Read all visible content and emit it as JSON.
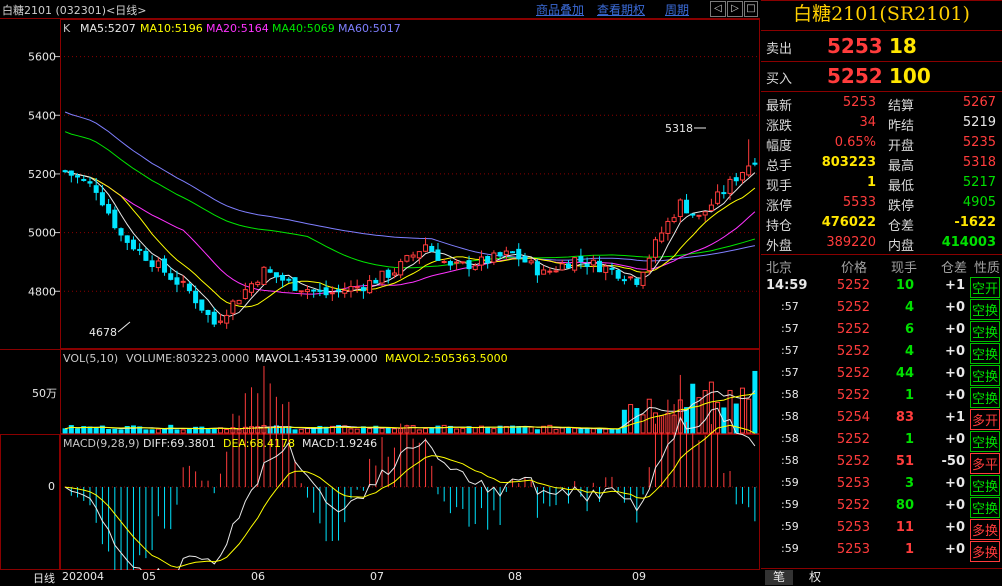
{
  "topbar": {
    "title": "白糖2101 (032301)<日线>",
    "links": [
      "商品叠加",
      "查看期权",
      "周期"
    ],
    "icons": [
      "arrow-left-icon",
      "arrow-right-icon",
      "restore-icon",
      "close-icon"
    ]
  },
  "kline": {
    "label": "K",
    "ma": [
      {
        "text": "MA5:5207",
        "color": "#e8e8e8"
      },
      {
        "text": "MA10:5196",
        "color": "#ffff00"
      },
      {
        "text": "MA20:5164",
        "color": "#ff33ff"
      },
      {
        "text": "MA40:5069",
        "color": "#00e600"
      },
      {
        "text": "MA60:5017",
        "color": "#7f7fff"
      }
    ],
    "yticks": [
      "5600",
      "5400",
      "5200",
      "5000",
      "4800"
    ],
    "ytick_values": [
      5600,
      5400,
      5200,
      5000,
      4800
    ],
    "ylim": [
      4610,
      5660
    ],
    "high_label": "5318",
    "low_label": "4678"
  },
  "volume": {
    "legend": [
      {
        "text": "VOL(5,10)",
        "color": "#c8c8c8"
      },
      {
        "text": "VOLUME:803223.0000",
        "color": "#c8c8c8"
      },
      {
        "text": "MAVOL1:453139.0000",
        "color": "#e8e8e8"
      },
      {
        "text": "MAVOL2:505363.5000",
        "color": "#ffff00"
      }
    ],
    "ytick": "50万"
  },
  "macd": {
    "legend": [
      {
        "text": "MACD(9,28,9)",
        "color": "#c8c8c8"
      },
      {
        "text": "DIFF:69.3801",
        "color": "#e8e8e8"
      },
      {
        "text": "DEA:68.4178",
        "color": "#ffff00"
      },
      {
        "text": "MACD:1.9246",
        "color": "#e8e8e8"
      }
    ],
    "ytick": "0"
  },
  "xaxis": {
    "period": "日线",
    "labels": [
      "202004",
      "05",
      "06",
      "07",
      "08",
      "09"
    ]
  },
  "quote": {
    "title": "白糖2101(SR2101)",
    "ask_label": "卖出",
    "ask_price": "5253",
    "ask_vol": "18",
    "bid_label": "买入",
    "bid_price": "5252",
    "bid_vol": "100",
    "stats": [
      [
        "最新",
        "5253",
        "结算",
        "5267"
      ],
      [
        "涨跌",
        "34",
        "昨结",
        "5219"
      ],
      [
        "幅度",
        "0.65%",
        "开盘",
        "5235"
      ],
      [
        "总手",
        "803223",
        "最高",
        "5318"
      ],
      [
        "现手",
        "1",
        "最低",
        "5217"
      ],
      [
        "涨停",
        "5533",
        "跌停",
        "4905"
      ],
      [
        "持仓",
        "476022",
        "仓差",
        "-1622"
      ],
      [
        "外盘",
        "389220",
        "内盘",
        "414003"
      ]
    ]
  },
  "ticks": {
    "headers": [
      "北京",
      "价格",
      "现手",
      "仓差",
      "性质"
    ],
    "rows": [
      [
        "14:59",
        "5252",
        "10",
        "+1",
        "空开"
      ],
      [
        ":57",
        "5252",
        "4",
        "+0",
        "空换"
      ],
      [
        ":57",
        "5252",
        "6",
        "+0",
        "空换"
      ],
      [
        ":57",
        "5252",
        "4",
        "+0",
        "空换"
      ],
      [
        ":57",
        "5252",
        "44",
        "+0",
        "空换"
      ],
      [
        ":58",
        "5252",
        "1",
        "+0",
        "空换"
      ],
      [
        ":58",
        "5254",
        "83",
        "+1",
        "多开"
      ],
      [
        ":58",
        "5252",
        "1",
        "+0",
        "空换"
      ],
      [
        ":58",
        "5252",
        "51",
        "-50",
        "多平"
      ],
      [
        ":59",
        "5253",
        "3",
        "+0",
        "空换"
      ],
      [
        ":59",
        "5252",
        "80",
        "+0",
        "空换"
      ],
      [
        ":59",
        "5253",
        "11",
        "+0",
        "多换"
      ],
      [
        ":59",
        "5253",
        "1",
        "+0",
        "多换"
      ]
    ]
  },
  "tabs": [
    "笔",
    "权"
  ],
  "colors": {
    "up": "#ff3c3c",
    "down": "#00e5ff",
    "grid": "#8a0000",
    "ma5": "#e8e8e8",
    "ma10": "#ffff00",
    "ma20": "#ff33ff",
    "ma40": "#00e600",
    "ma60": "#7f7fff"
  },
  "chart_data": {
    "type": "candlestick",
    "title": "白糖2101 (032301)<日线>",
    "x_month_labels": [
      "202004",
      "05",
      "06",
      "07",
      "08",
      "09"
    ],
    "ohlc_monthly_approx": [
      {
        "x": "202004",
        "open": 5210,
        "high": 5230,
        "low": 4678,
        "close": 4780
      },
      {
        "x": "05",
        "open": 4780,
        "high": 4960,
        "low": 4740,
        "close": 4820
      },
      {
        "x": "06",
        "open": 4820,
        "high": 5020,
        "low": 4760,
        "close": 4900
      },
      {
        "x": "07",
        "open": 4900,
        "high": 4980,
        "low": 4810,
        "close": 4920
      },
      {
        "x": "08",
        "open": 4920,
        "high": 5180,
        "low": 4780,
        "close": 5080
      },
      {
        "x": "09",
        "open": 5080,
        "high": 5318,
        "low": 5060,
        "close": 5253
      }
    ],
    "ma_last": {
      "MA5": 5207,
      "MA10": 5196,
      "MA20": 5164,
      "MA40": 5069,
      "MA60": 5017
    },
    "volume_last": 803223,
    "macd_last": {
      "DIFF": 69.3801,
      "DEA": 68.4178,
      "MACD": 1.9246
    },
    "ylim": [
      4610,
      5660
    ]
  }
}
